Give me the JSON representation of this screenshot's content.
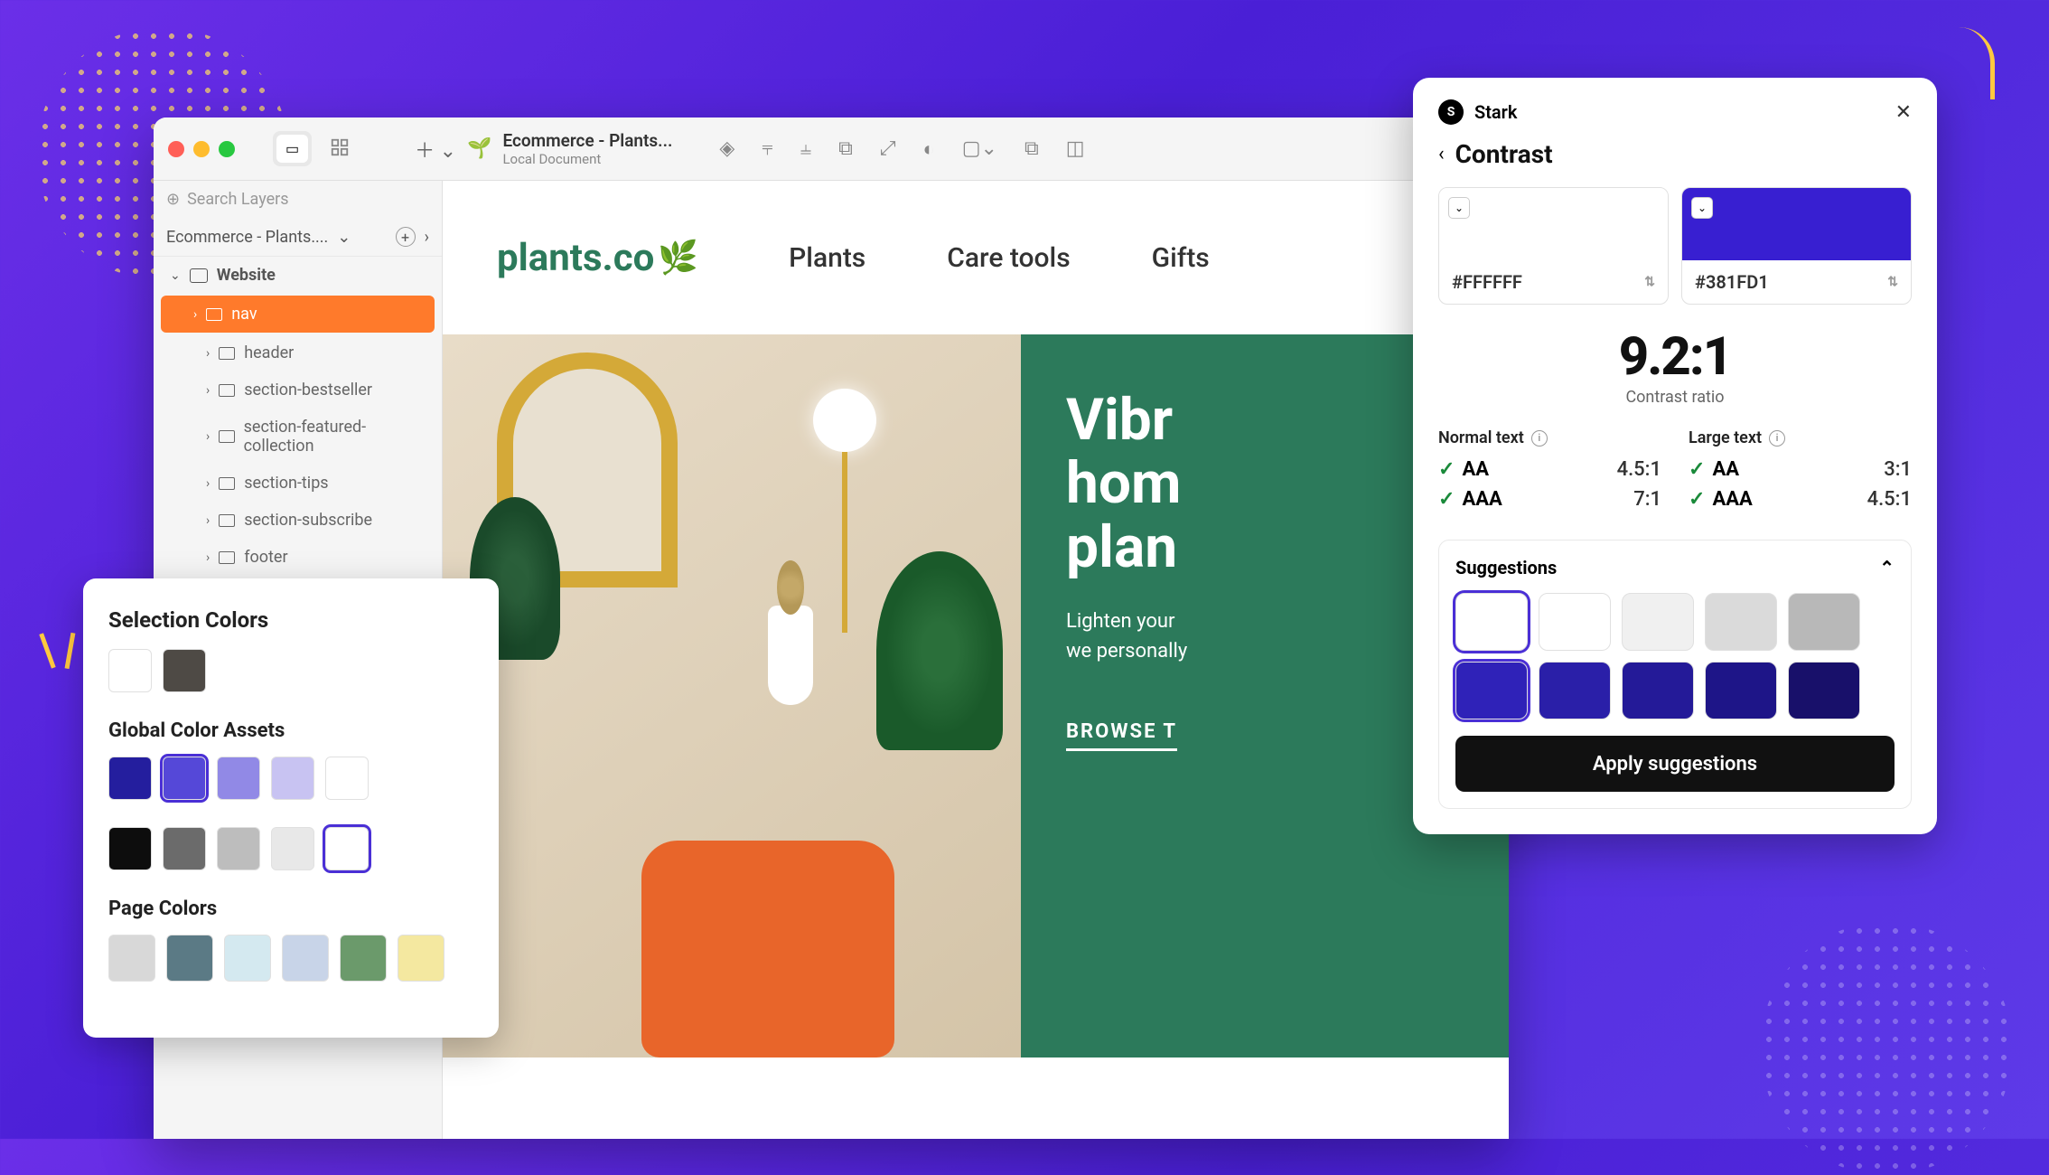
{
  "editor": {
    "doc_title": "Ecommerce - Plants...",
    "doc_subtitle": "Local Document",
    "search_placeholder": "Search Layers",
    "breadcrumb": "Ecommerce - Plants....",
    "layers": {
      "root": "Website",
      "items": [
        "nav",
        "header",
        "section-bestseller",
        "section-featured-collection",
        "section-tips",
        "section-subscribe",
        "footer"
      ]
    }
  },
  "site": {
    "logo": "plants.co",
    "nav": [
      "Plants",
      "Care tools",
      "Gifts"
    ],
    "hero_title_l1": "Vibr",
    "hero_title_l2": "hom",
    "hero_title_l3": "plan",
    "hero_p_l1": "Lighten your",
    "hero_p_l2": "we personally",
    "hero_link": "BROWSE T"
  },
  "colors_panel": {
    "selection_title": "Selection Colors",
    "selection": [
      "#FFFFFF",
      "#4E4A45"
    ],
    "global_title": "Global Color Assets",
    "global_row1": [
      "#241E9E",
      "#5548D8",
      "#9189E6",
      "#C8C3F2",
      "#FFFFFF"
    ],
    "global_row2": [
      "#0D0D0D",
      "#6B6B6B",
      "#BDBDBD",
      "#E8E8E8",
      "#FFFFFF"
    ],
    "page_title": "Page Colors",
    "page_row": [
      "#D8D8D8",
      "#5B7A85",
      "#D4E9F0",
      "#C8D4E8",
      "#6B9A6B",
      "#F4E8A0"
    ]
  },
  "stark": {
    "brand": "Stark",
    "title": "Contrast",
    "fg_color": "#FFFFFF",
    "bg_color": "#381FD1",
    "ratio": "9.2:1",
    "ratio_label": "Contrast ratio",
    "normal_label": "Normal text",
    "large_label": "Large text",
    "normal": [
      {
        "level": "AA",
        "req": "4.5:1"
      },
      {
        "level": "AAA",
        "req": "7:1"
      }
    ],
    "large": [
      {
        "level": "AA",
        "req": "3:1"
      },
      {
        "level": "AAA",
        "req": "4.5:1"
      }
    ],
    "suggestions_label": "Suggestions",
    "suggestion_light": [
      "#FFFFFF",
      "#FFFFFF",
      "#F0F0F0",
      "#DADADA",
      "#B8B8B8"
    ],
    "suggestion_dark": [
      "#2F22B8",
      "#2A1FA8",
      "#241A98",
      "#1E1588",
      "#18106A"
    ],
    "apply_label": "Apply suggestions"
  }
}
